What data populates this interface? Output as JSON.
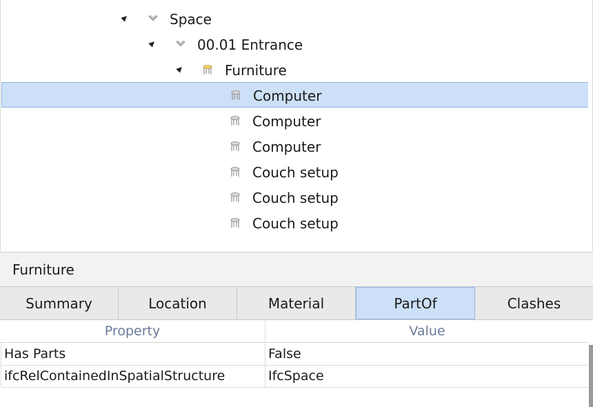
{
  "tree": {
    "nodes": [
      {
        "label": "Space",
        "icon": "space-icon",
        "expanded": true
      },
      {
        "label": "00.01 Entrance",
        "icon": "space-icon",
        "expanded": true
      },
      {
        "label": "Furniture",
        "icon": "furniture-group-icon",
        "expanded": true
      },
      {
        "label": "Computer",
        "icon": "furniture-icon",
        "selected": true
      },
      {
        "label": "Computer",
        "icon": "furniture-icon"
      },
      {
        "label": "Computer",
        "icon": "furniture-icon"
      },
      {
        "label": "Couch setup",
        "icon": "furniture-icon"
      },
      {
        "label": "Couch setup",
        "icon": "furniture-icon"
      },
      {
        "label": "Couch setup",
        "icon": "furniture-icon"
      }
    ]
  },
  "properties": {
    "title": "Furniture",
    "tabs": [
      {
        "label": "Summary"
      },
      {
        "label": "Location"
      },
      {
        "label": "Material"
      },
      {
        "label": "PartOf",
        "active": true
      },
      {
        "label": "Clashes"
      }
    ],
    "columns": {
      "property": "Property",
      "value": "Value"
    },
    "rows": [
      {
        "property": "Has Parts",
        "value": "False"
      },
      {
        "property": "ifcRelContainedInSpatialStructure",
        "value": "IfcSpace"
      }
    ]
  },
  "colors": {
    "selection": "#cce0f7",
    "selection_border": "#8fb6e3",
    "header_text": "#6a7a9a",
    "furniture_group_icon": "#f0d070"
  }
}
